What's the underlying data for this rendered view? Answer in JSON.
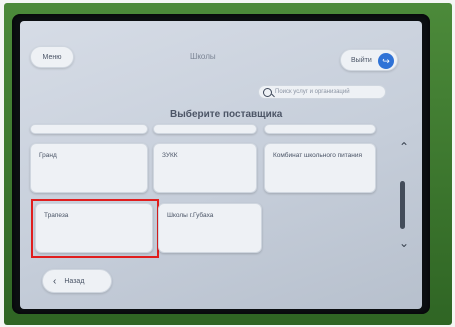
{
  "header": {
    "menu_label": "Меню",
    "title": "Школы",
    "exit_label": "Выйти"
  },
  "search": {
    "placeholder": "Поиск услуг и организаций"
  },
  "heading": "Выберите поставщика",
  "providers": [
    {
      "label": "Гранд"
    },
    {
      "label": "ЗУКК"
    },
    {
      "label": "Комбинат школьного питания"
    },
    {
      "label": "Трапеза",
      "selected": true
    },
    {
      "label": "Школы г.Губаха"
    }
  ],
  "footer": {
    "back_label": "Назад"
  },
  "colors": {
    "selection_outline": "#e01e1e",
    "exit_accent": "#2f72d6"
  }
}
